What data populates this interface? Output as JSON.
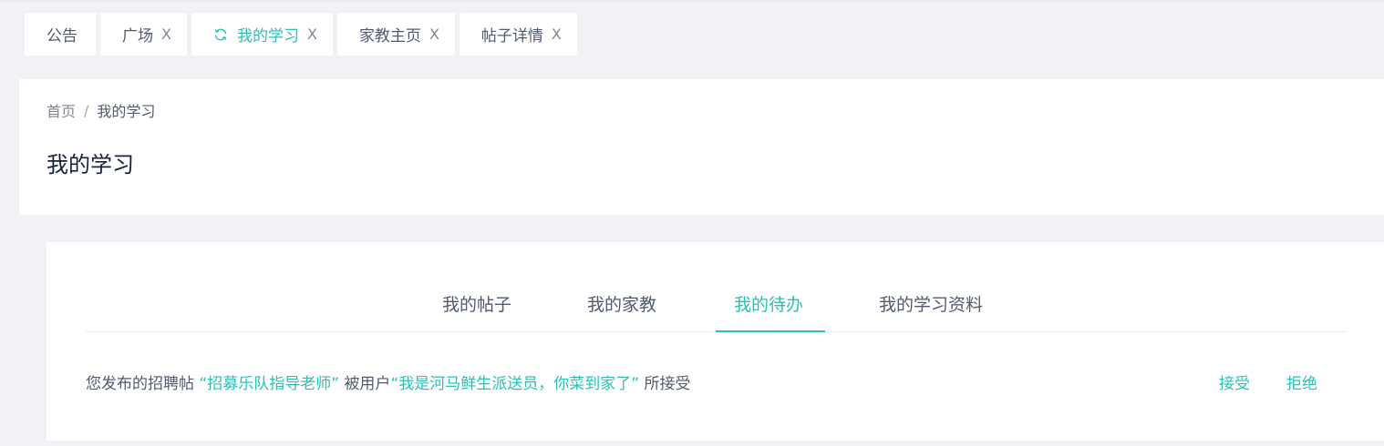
{
  "tabs": [
    {
      "label": "公告",
      "closable": false,
      "active": false
    },
    {
      "label": "广场",
      "closable": true,
      "active": false
    },
    {
      "label": "我的学习",
      "closable": true,
      "active": true
    },
    {
      "label": "家教主页",
      "closable": true,
      "active": false
    },
    {
      "label": "帖子详情",
      "closable": true,
      "active": false
    }
  ],
  "tab_close_glyph": "X",
  "breadcrumb": {
    "home": "首页",
    "separator": "/",
    "current": "我的学习"
  },
  "page_title": "我的学习",
  "subtabs": [
    {
      "label": "我的帖子",
      "active": false
    },
    {
      "label": "我的家教",
      "active": false
    },
    {
      "label": "我的待办",
      "active": true
    },
    {
      "label": "我的学习资料",
      "active": false
    }
  ],
  "todo": {
    "prefix": "您发布的招聘帖",
    "post_title": "“招募乐队指导老师”",
    "middle": "被用户",
    "user_name": "“我是河马鲜生派送员，你菜到家了”",
    "suffix": "所接受",
    "accept_label": "接受",
    "reject_label": "拒绝"
  },
  "colors": {
    "accent": "#2bc0b4",
    "text": "#515a6e",
    "background": "#f0f2f5"
  }
}
